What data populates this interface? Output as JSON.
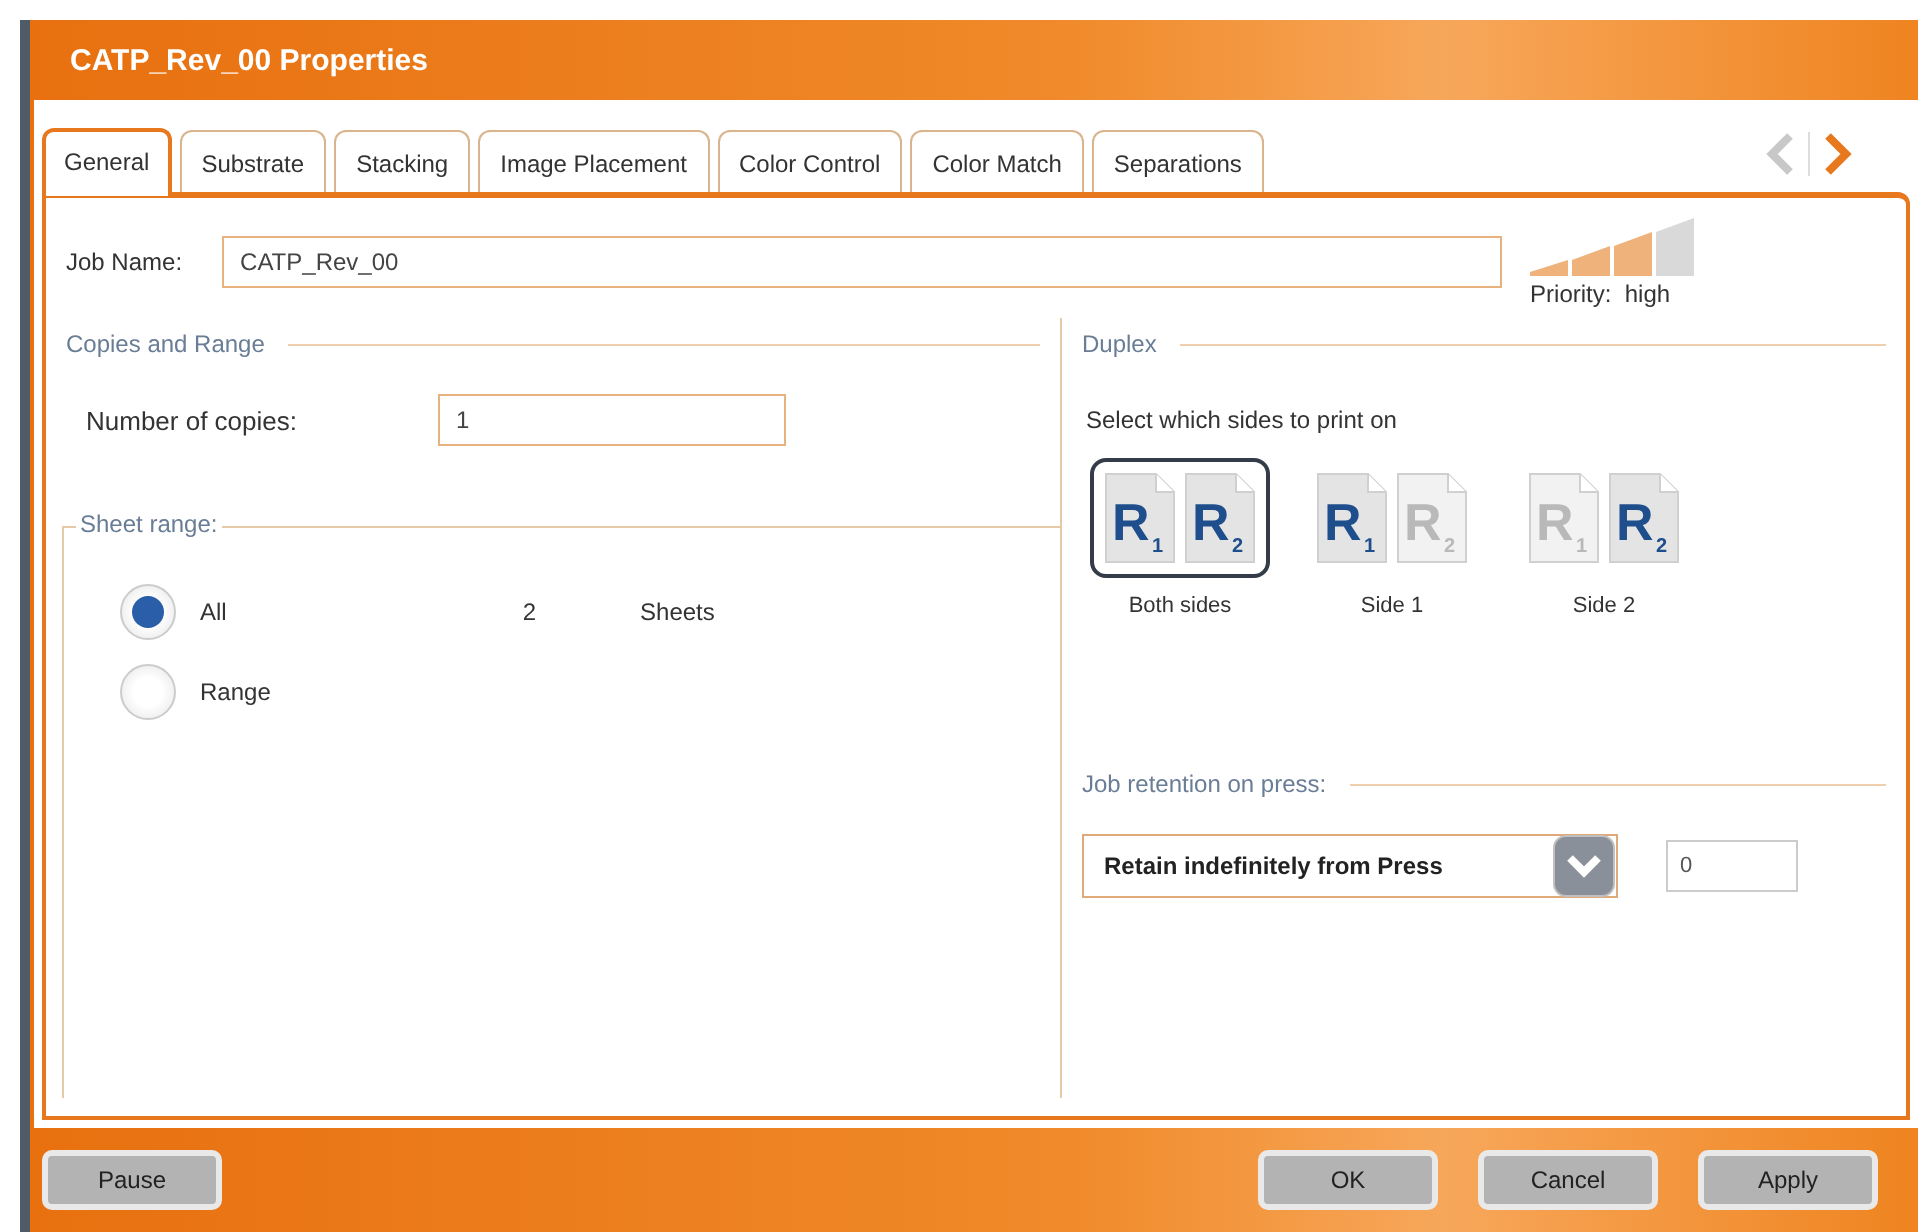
{
  "window": {
    "title": "CATP_Rev_00  Properties"
  },
  "tabs": [
    {
      "label": "General",
      "selected": true
    },
    {
      "label": "Substrate",
      "selected": false
    },
    {
      "label": "Stacking",
      "selected": false
    },
    {
      "label": "Image Placement",
      "selected": false
    },
    {
      "label": "Color Control",
      "selected": false
    },
    {
      "label": "Color Match",
      "selected": false
    },
    {
      "label": "Separations",
      "selected": false
    }
  ],
  "tab_nav": {
    "previous_disabled": true,
    "next_disabled": false
  },
  "job_name": {
    "label": "Job Name:",
    "value": "CATP_Rev_00"
  },
  "priority": {
    "label": "Priority:",
    "value": "high",
    "level": 0.75
  },
  "copies_and_range": {
    "heading": "Copies and Range",
    "copies_label": "Number of copies:",
    "copies_value": "1",
    "sheet_range": {
      "heading": "Sheet range:",
      "options": [
        {
          "label": "All",
          "selected": true
        },
        {
          "label": "Range",
          "selected": false
        }
      ],
      "sheet_count": "2",
      "sheet_unit": "Sheets"
    }
  },
  "duplex": {
    "heading": "Duplex",
    "instruction": "Select which sides to print on",
    "options": [
      {
        "label": "Both sides",
        "selected": true,
        "pages": [
          {
            "letter": "R",
            "number": "1",
            "active": true
          },
          {
            "letter": "R",
            "number": "2",
            "active": true
          }
        ]
      },
      {
        "label": "Side 1",
        "selected": false,
        "pages": [
          {
            "letter": "R",
            "number": "1",
            "active": true
          },
          {
            "letter": "R",
            "number": "2",
            "active": false
          }
        ]
      },
      {
        "label": "Side 2",
        "selected": false,
        "pages": [
          {
            "letter": "R",
            "number": "1",
            "active": false
          },
          {
            "letter": "R",
            "number": "2",
            "active": true
          }
        ]
      }
    ]
  },
  "job_retention": {
    "heading": "Job retention on press:",
    "selection": "Retain indefinitely from Press",
    "value": "0"
  },
  "footer": {
    "left_buttons": [
      "Pause"
    ],
    "right_buttons": [
      "OK",
      "Cancel",
      "Apply"
    ]
  }
}
